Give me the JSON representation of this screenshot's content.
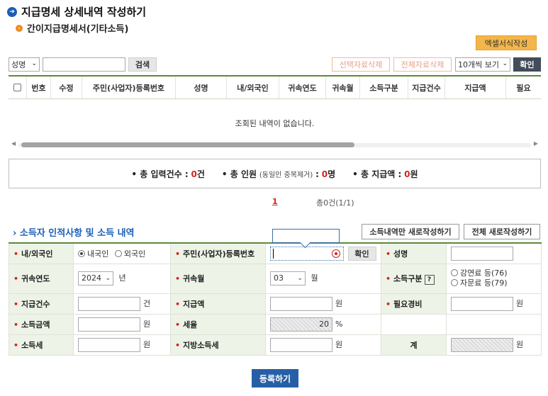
{
  "header": {
    "title": "지급명세 상세내역 작성하기",
    "subtitle": "간이지급명세서(기타소득)",
    "excel_button": "엑셀서식작성"
  },
  "toolbar": {
    "search_field": "성명",
    "search_button": "검색",
    "delete_selected": "선택자료삭제",
    "delete_all": "전체자료삭제",
    "page_size": "10개씩 보기",
    "confirm": "확인"
  },
  "grid": {
    "columns": [
      "번호",
      "수정",
      "주민(사업자)등록번호",
      "성명",
      "내/외국인",
      "귀속연도",
      "귀속월",
      "소득구분",
      "지급건수",
      "지급액",
      "필요"
    ],
    "empty_message": "조회된 내역이 없습니다."
  },
  "summary": {
    "total_entries_label": "총 입력건수 :",
    "total_entries_value": "0",
    "total_entries_unit": "건",
    "total_people_label": "총 인원",
    "total_people_note": "(동일인 중복제거)",
    "total_people_colon": ":",
    "total_people_value": "0",
    "total_people_unit": "명",
    "total_amount_label": "총 지급액 :",
    "total_amount_value": "0",
    "total_amount_unit": "원"
  },
  "pager": {
    "current": "1",
    "info": "총0건(1/1)"
  },
  "form": {
    "section_title": "소득자 인적사항 및 소득 내역",
    "btn_new_income": "소득내역만 새로작성하기",
    "btn_new_all": "전체 새로작성하기",
    "nationality_label": "내/외국인",
    "nationality_domestic": "내국인",
    "nationality_foreign": "외국인",
    "rrn_label": "주민(사업자)등록번호",
    "rrn_confirm": "확인",
    "name_label": "성명",
    "year_label": "귀속연도",
    "year_value": "2024",
    "year_unit": "년",
    "month_label": "귀속월",
    "month_value": "03",
    "month_unit": "월",
    "income_type_label": "소득구분",
    "income_type_help": "?",
    "income_type_opt1": "강연료 등(76)",
    "income_type_opt2": "자문료 등(79)",
    "count_label": "지급건수",
    "count_unit": "건",
    "amount_label": "지급액",
    "amount_unit": "원",
    "expense_label": "필요경비",
    "expense_unit": "원",
    "income_label": "소득금액",
    "income_unit": "원",
    "tax_rate_label": "세율",
    "tax_rate_value": "20",
    "tax_rate_unit": "%",
    "income_tax_label": "소득세",
    "income_tax_unit": "원",
    "local_tax_label": "지방소득세",
    "local_tax_unit": "원",
    "total_label": "계",
    "total_unit": "원"
  },
  "register_button": "등록하기",
  "colors": {
    "accent_green": "#5a8a3a",
    "header_bg": "#edf3e6",
    "primary_blue": "#275fa6",
    "highlight_red": "#d0261c"
  }
}
